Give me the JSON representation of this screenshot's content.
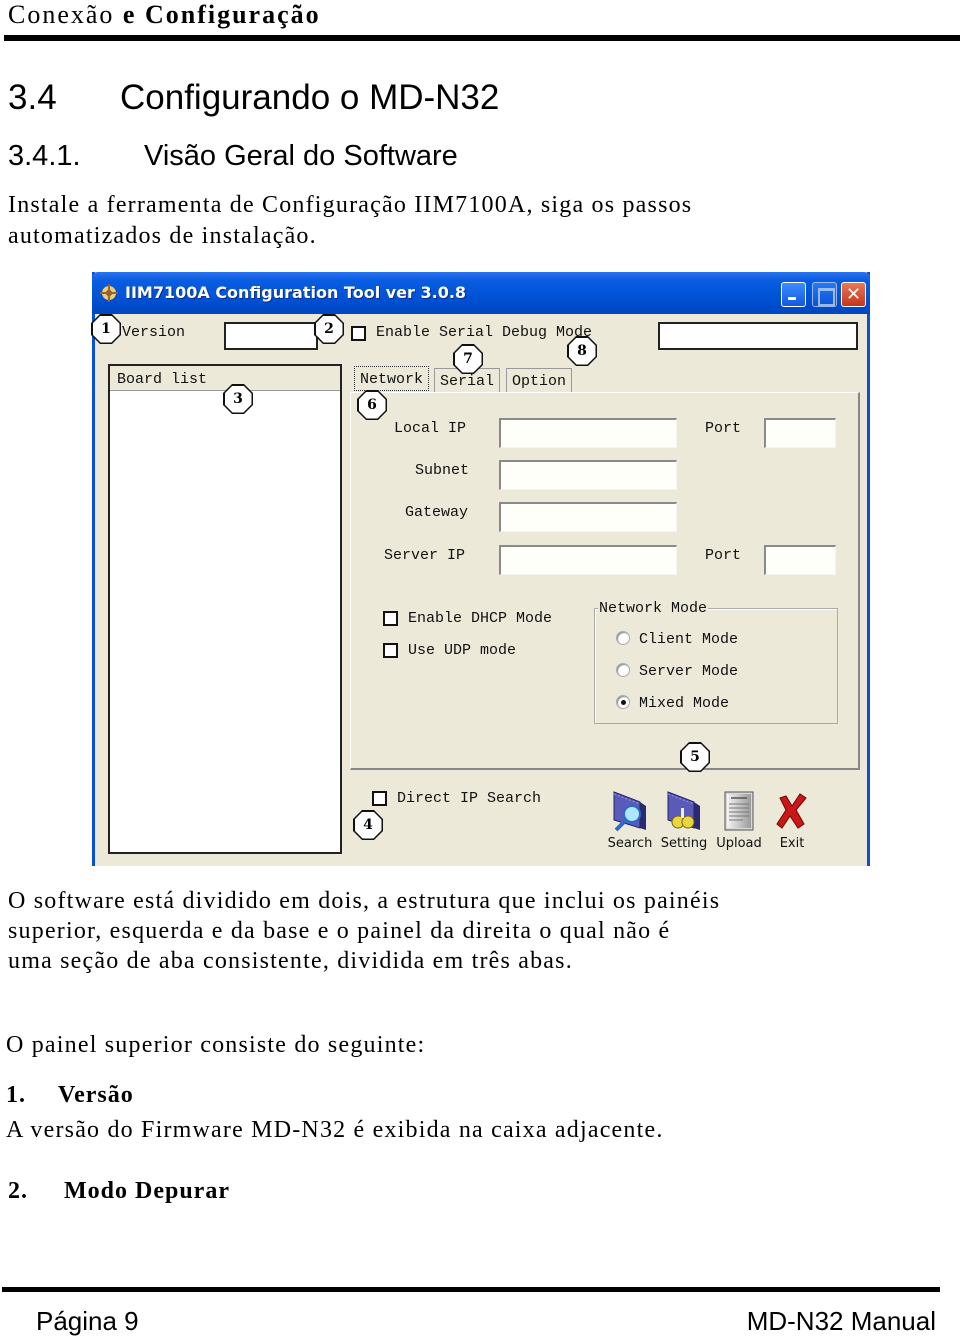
{
  "header": {
    "title_regular": "Conexão",
    "title_bold": "e Configuração"
  },
  "section": {
    "number": "3.4",
    "title": "Configurando o MD-N32"
  },
  "subsection": {
    "number": "3.4.1.",
    "title": "Visão Geral do Software"
  },
  "intro_lines": [
    "Instale a ferramenta de Configuração IIM7100A, siga os passos",
    "automatizados de instalação."
  ],
  "app_window": {
    "title": "IIM7100A Configuration Tool ver 3.0.8",
    "version_label": "Version",
    "version_value": "",
    "debug_checkbox_label": "Enable Serial Debug Mode",
    "debug_checked": false,
    "debug_value": "",
    "board_list_header": "Board list",
    "tabs": [
      {
        "label": "Network",
        "active": true
      },
      {
        "label": "Serial",
        "active": false
      },
      {
        "label": "Option",
        "active": false
      }
    ],
    "fields": {
      "local_ip_label": "Local IP",
      "local_ip_value": "",
      "local_port_label": "Port",
      "local_port_value": "",
      "subnet_label": "Subnet",
      "subnet_value": "",
      "gateway_label": "Gateway",
      "gateway_value": "",
      "server_ip_label": "Server IP",
      "server_ip_value": "",
      "server_port_label": "Port",
      "server_port_value": ""
    },
    "dhcp_label": "Enable DHCP Mode",
    "dhcp_checked": false,
    "udp_label": "Use UDP mode",
    "udp_checked": false,
    "network_mode": {
      "legend": "Network Mode",
      "options": [
        {
          "label": "Client Mode",
          "selected": false
        },
        {
          "label": "Server Mode",
          "selected": false
        },
        {
          "label": "Mixed Mode",
          "selected": true
        }
      ]
    },
    "direct_ip_label": "Direct IP Search",
    "direct_ip_checked": false,
    "toolbar": [
      {
        "label": "Search",
        "icon": "search-icon"
      },
      {
        "label": "Setting",
        "icon": "setting-icon"
      },
      {
        "label": "Upload",
        "icon": "upload-icon"
      },
      {
        "label": "Exit",
        "icon": "exit-icon"
      }
    ],
    "markers": [
      "1",
      "2",
      "3",
      "4",
      "5",
      "6",
      "7",
      "8"
    ]
  },
  "description_lines": [
    "O software está dividido em dois, a estrutura que inclui os painéis",
    "superior, esquerda e da base e o painel da direita o qual não é",
    "uma seção de aba consistente, dividida em três abas."
  ],
  "top_panel_intro": "O painel superior consiste do seguinte:",
  "items": [
    {
      "number": "1.",
      "title": "Versão",
      "text": "A versão do Firmware MD-N32 é exibida na caixa adjacente."
    },
    {
      "number": "2.",
      "title": "Modo Depurar",
      "text": ""
    }
  ],
  "footer": {
    "page": "Página 9",
    "manual": "MD-N32 Manual"
  },
  "colors": {
    "titlebar": "#0052d6",
    "window_bg": "#ece9d8",
    "close_button": "#c2361a"
  }
}
